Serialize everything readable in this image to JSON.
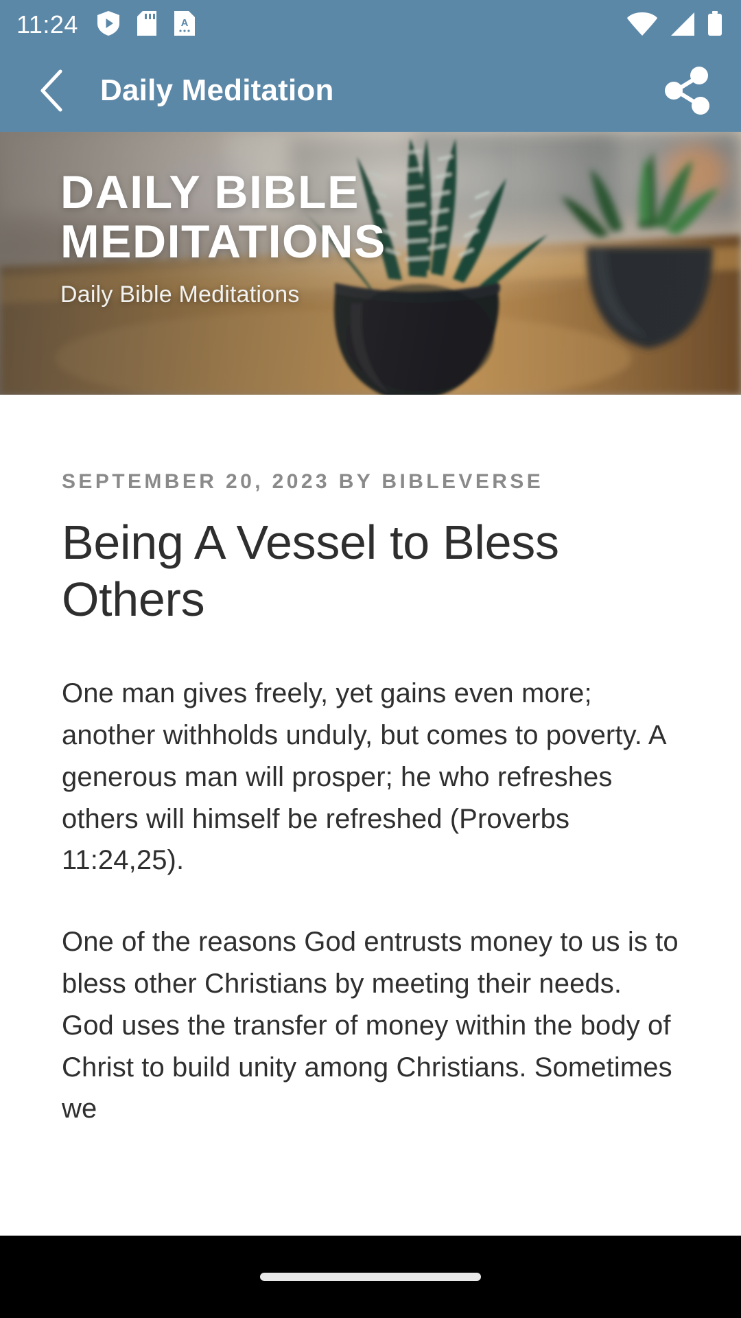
{
  "status_bar": {
    "time": "11:24",
    "left_icons": [
      "shield-play-icon",
      "sd-card-icon",
      "document-a-icon"
    ],
    "right_icons": [
      "wifi-icon",
      "cell-signal-icon",
      "battery-icon"
    ],
    "background_color": "#5c88a8"
  },
  "app_bar": {
    "back_label": "back-arrow",
    "title": "Daily Meditation",
    "share_label": "share",
    "background_color": "#5c88a8",
    "text_color": "#ffffff"
  },
  "hero": {
    "title": "Daily Bible Meditations",
    "subtitle": "Daily Bible Meditations",
    "image_description": "blurred photo of potted zebra succulent plants on a wooden table"
  },
  "article": {
    "meta": "SEPTEMBER 20, 2023 BY BIBLEVERSE",
    "date": "September 20, 2023",
    "author": "BIBLEVERSE",
    "title": "Being A Vessel to Bless Others",
    "paragraphs": [
      "One man gives freely, yet gains even more; another withholds unduly, but comes to poverty. A generous man will prosper; he who refreshes others will himself be refreshed (Proverbs 11:24,25).",
      "One of the reasons God entrusts money to us is to bless other Christians by meeting their needs. God uses the transfer of money within the body of Christ to build unity among Christians. Sometimes we"
    ],
    "meta_color": "#8a8a8a",
    "title_color": "#2e2e2e",
    "body_color": "#2f2f2f"
  },
  "nav_bar": {
    "home_indicator": "home-gesture-pill",
    "background_color": "#000000"
  }
}
